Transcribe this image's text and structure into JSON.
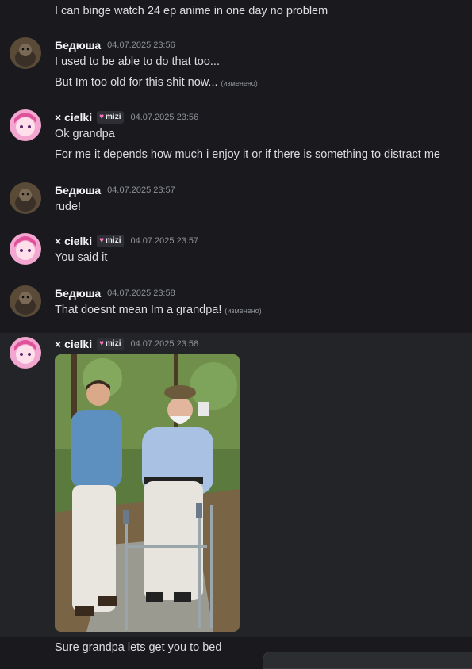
{
  "messages": [
    {
      "text": "I can binge watch 24 ep anime in one day no problem"
    },
    {
      "author": "Бедюша",
      "timestamp": "04.07.2025 23:56",
      "lines": [
        "I used to be able to do that too...",
        "But Im too old for this shit now..."
      ],
      "edited": "(изменено)"
    },
    {
      "author": "× cielki",
      "tag": "mizi",
      "timestamp": "04.07.2025 23:56",
      "lines": [
        "Ok grandpa",
        "For me it depends how much i enjoy it or if there is something to distract me"
      ]
    },
    {
      "author": "Бедюша",
      "timestamp": "04.07.2025 23:57",
      "lines": [
        "rude!"
      ]
    },
    {
      "author": "× cielki",
      "tag": "mizi",
      "timestamp": "04.07.2025 23:57",
      "lines": [
        "You said it"
      ]
    },
    {
      "author": "Бедюша",
      "timestamp": "04.07.2025 23:58",
      "lines": [
        "That doesnt mean Im a grandpa!"
      ],
      "edited": "(изменено)"
    },
    {
      "author": "× cielki",
      "tag": "mizi",
      "timestamp": "04.07.2025 23:58",
      "lines": [
        "Sure grandpa lets get you to bed"
      ]
    }
  ],
  "icons": {
    "tag_icon": "heart-icon",
    "avatar_bedusha": "cat-avatar",
    "avatar_cielki": "pink-hair-avatar"
  },
  "colors": {
    "background": "#1a1a1e",
    "highlight": "#232428",
    "tag_heart": "#ff70c0"
  }
}
